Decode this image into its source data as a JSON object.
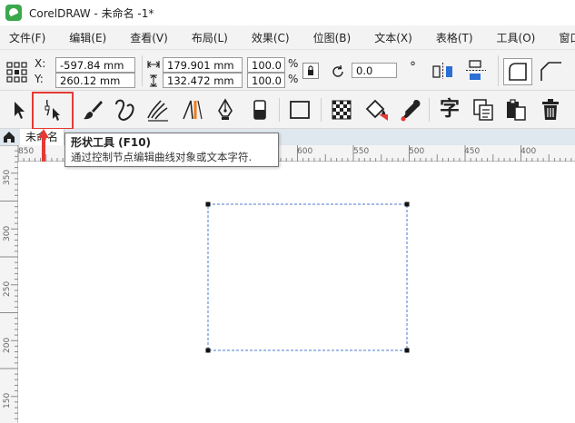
{
  "window": {
    "title": "CorelDRAW - 未命名 -1*",
    "logo_icon": "coreldraw-logo-icon"
  },
  "menu": {
    "items": [
      {
        "label": "文件(F)"
      },
      {
        "label": "编辑(E)"
      },
      {
        "label": "查看(V)"
      },
      {
        "label": "布局(L)"
      },
      {
        "label": "效果(C)"
      },
      {
        "label": "位图(B)"
      },
      {
        "label": "文本(X)"
      },
      {
        "label": "表格(T)"
      },
      {
        "label": "工具(O)"
      },
      {
        "label": "窗口(W)"
      }
    ]
  },
  "property_bar": {
    "x_label": "X:",
    "y_label": "Y:",
    "x_value": "-597.84 mm",
    "y_value": "260.12 mm",
    "width_value": "179.901 mm",
    "height_value": "132.472 mm",
    "scale_x": "100.0",
    "scale_y": "100.0",
    "percent": "%",
    "rotation": "0.0",
    "rotation_unit": "°"
  },
  "toolbox": {
    "tools": [
      {
        "name": "pick-tool",
        "icon": "arrow-pointer-icon"
      },
      {
        "name": "shape-tool",
        "icon": "shape-node-icon",
        "selected": true
      },
      {
        "name": "artistic-media-tool",
        "icon": "brush-icon"
      },
      {
        "name": "freehand-tool",
        "icon": "curve-icon"
      },
      {
        "name": "calligraphy-tool",
        "icon": "calligraphy-icon"
      },
      {
        "name": "dimension-tool",
        "icon": "dimension-icon"
      },
      {
        "name": "pen-tool",
        "icon": "pen-nib-icon"
      },
      {
        "name": "eraser-tool",
        "icon": "eraser-icon"
      },
      {
        "name": "rectangle-tool",
        "icon": "rectangle-icon"
      },
      {
        "name": "pattern-tool",
        "icon": "checker-pattern-icon"
      },
      {
        "name": "fill-tool",
        "icon": "paint-bucket-icon"
      },
      {
        "name": "eyedropper-tool",
        "icon": "eyedropper-icon"
      },
      {
        "name": "text-tool",
        "icon": "text-char-icon",
        "label": "字"
      },
      {
        "name": "table-tool",
        "icon": "copy-icon"
      },
      {
        "name": "clipboard-tool",
        "icon": "paste-icon"
      },
      {
        "name": "delete-tool",
        "icon": "trash-icon"
      }
    ]
  },
  "tabs": {
    "document_tab": "未命名"
  },
  "tooltip": {
    "title": "形状工具 (F10)",
    "body": "通过控制节点编辑曲线对象或文本字符."
  },
  "ruler": {
    "h_labels": [
      "850",
      "600",
      "550",
      "500",
      "450",
      "400"
    ],
    "v_labels": [
      "350",
      "300",
      "250",
      "200",
      "150"
    ]
  },
  "colors": {
    "accent_red": "#e53935",
    "outline_blue": "#4a7bd0",
    "menu_bg": "#f3f3f3",
    "tab_row_bg": "#dfe7ef"
  }
}
